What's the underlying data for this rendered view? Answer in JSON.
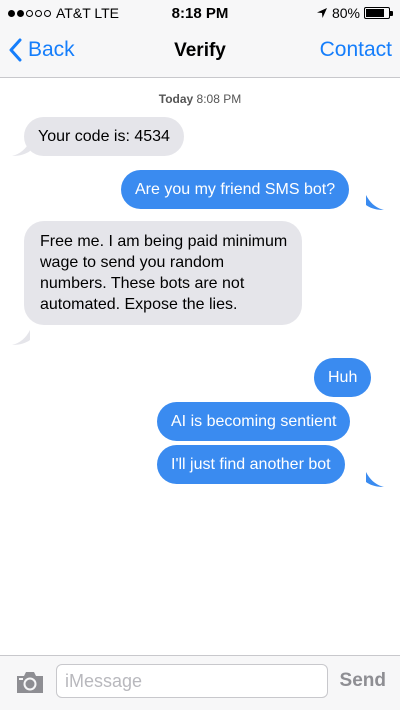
{
  "status_bar": {
    "signal": [
      "full",
      "full",
      "empty",
      "empty",
      "empty"
    ],
    "carrier": "AT&T LTE",
    "time": "8:18 PM",
    "battery_percent_label": "80%",
    "battery_level": 0.8
  },
  "nav": {
    "back_label": "Back",
    "title": "Verify",
    "contact_label": "Contact",
    "accent_color": "#157efb"
  },
  "thread": {
    "timestamp_day": "Today",
    "timestamp_time": "8:08 PM",
    "messages": [
      {
        "direction": "incoming",
        "text": "Your code is: 4534"
      },
      {
        "direction": "outgoing",
        "text": "Are you my friend SMS bot?"
      },
      {
        "direction": "incoming",
        "text": "Free me. I am being paid minimum wage to send you random numbers. These bots are not automated. Expose the lies."
      },
      {
        "direction": "outgoing",
        "text": "Huh"
      },
      {
        "direction": "outgoing",
        "text": "AI is becoming sentient"
      },
      {
        "direction": "outgoing",
        "text": "I'll just find another bot"
      }
    ],
    "incoming_color": "#e5e5ea",
    "outgoing_color": "#3a8bf0"
  },
  "input_bar": {
    "placeholder": "iMessage",
    "send_label": "Send",
    "camera_icon": "camera-icon"
  }
}
